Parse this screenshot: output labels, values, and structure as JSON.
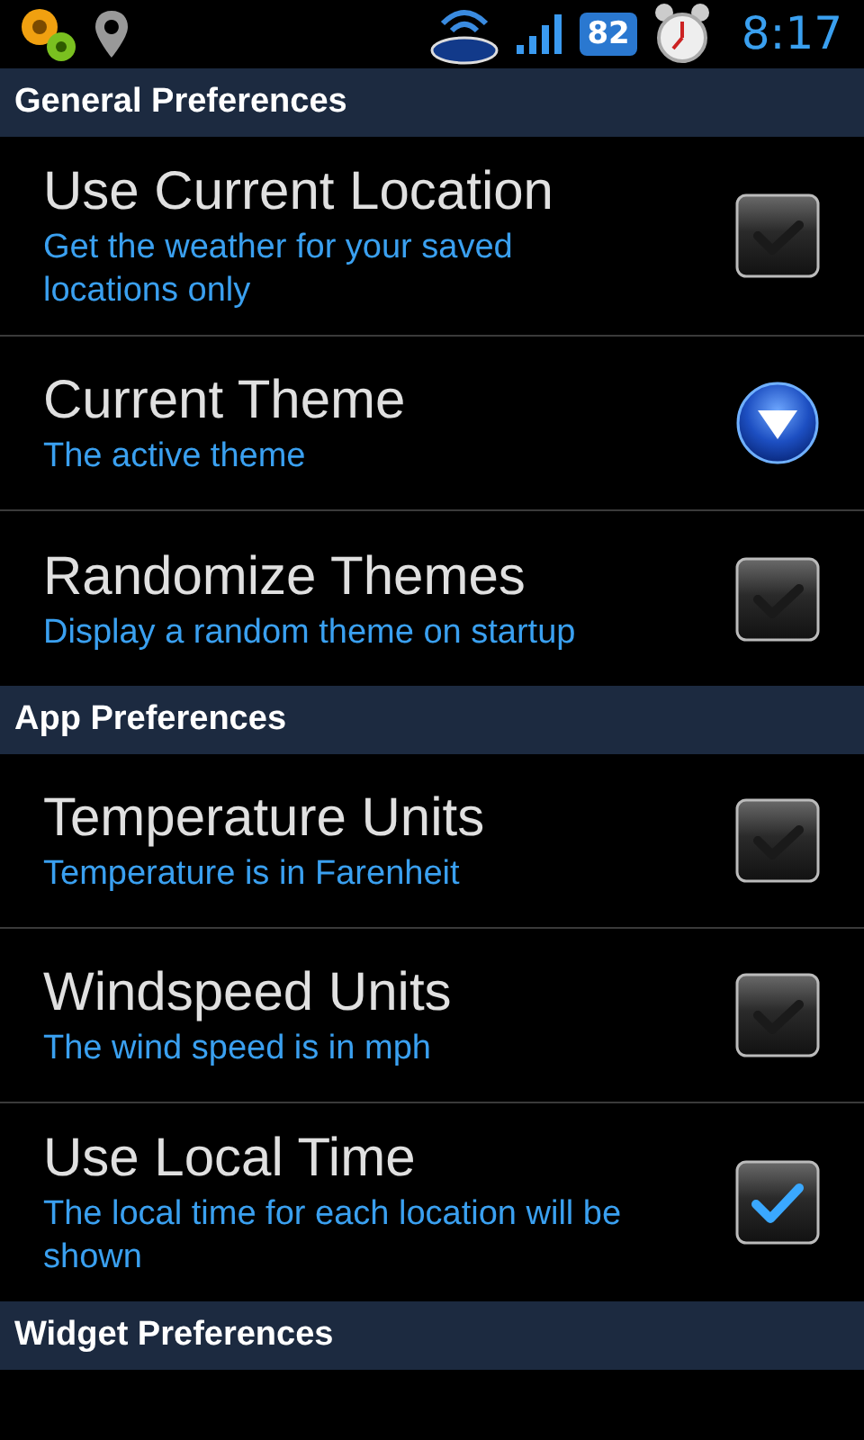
{
  "status_bar": {
    "battery": "82",
    "time": "8:17"
  },
  "sections": [
    {
      "title": "General Preferences",
      "items": [
        {
          "kind": "checkbox",
          "title": "Use Current Location",
          "summary": "Get the weather for your saved locations only",
          "checked": false
        },
        {
          "kind": "dropdown",
          "title": "Current Theme",
          "summary": "The active theme"
        },
        {
          "kind": "checkbox",
          "title": "Randomize Themes",
          "summary": "Display a random theme on startup",
          "checked": false
        }
      ]
    },
    {
      "title": "App Preferences",
      "items": [
        {
          "kind": "checkbox",
          "title": "Temperature Units",
          "summary": "Temperature is in Farenheit",
          "checked": false
        },
        {
          "kind": "checkbox",
          "title": "Windspeed Units",
          "summary": "The wind speed is in mph",
          "checked": false
        },
        {
          "kind": "checkbox",
          "title": "Use Local Time",
          "summary": "The local time for each location will be shown",
          "checked": true
        }
      ]
    },
    {
      "title": "Widget Preferences"
    }
  ]
}
